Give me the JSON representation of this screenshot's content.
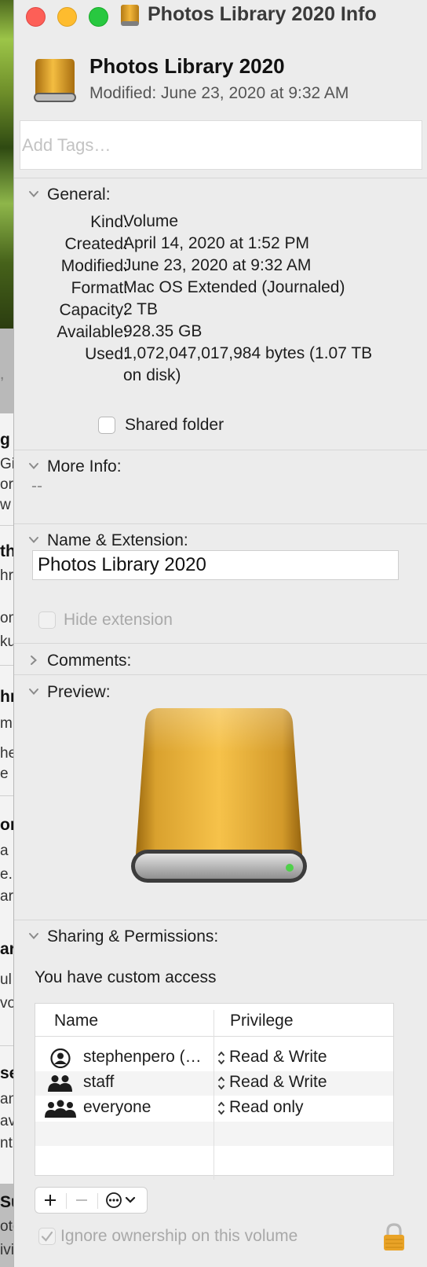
{
  "background": {
    "fragments": [
      ", ",
      "g",
      "Gif",
      "ore",
      "w",
      "th",
      "hri",
      "om",
      "ku",
      "hr",
      "m.",
      "he",
      "e u",
      "or",
      "a",
      "e.",
      "ar",
      "ar",
      "ea",
      "ul",
      "vo",
      "se",
      "an",
      "av",
      "nt",
      "Su",
      "oto",
      "ivi"
    ]
  },
  "window": {
    "title": "Photos Library 2020 Info",
    "controls": [
      "close",
      "minimize",
      "zoom"
    ]
  },
  "header": {
    "name": "Photos Library 2020",
    "modified": "Modified: June 23, 2020 at 9:32 AM"
  },
  "tags": {
    "placeholder": "Add Tags…",
    "value": ""
  },
  "general": {
    "title": "General:",
    "rows": [
      {
        "label": "Kind:",
        "value": "Volume"
      },
      {
        "label": "Created:",
        "value": "April 14, 2020 at 1:52 PM"
      },
      {
        "label": "Modified:",
        "value": "June 23, 2020 at 9:32 AM"
      },
      {
        "label": "Format:",
        "value": "Mac OS Extended (Journaled)"
      },
      {
        "label": "Capacity:",
        "value": "2 TB"
      },
      {
        "label": "Available:",
        "value": "928.35 GB"
      },
      {
        "label": "Used:",
        "value_line1": "1,072,047,017,984 bytes (1.07 TB",
        "value_line2": "on disk)"
      }
    ],
    "shared_folder": {
      "label": "Shared folder",
      "checked": false
    }
  },
  "more_info": {
    "title": "More Info:",
    "value": "--"
  },
  "name_extension": {
    "title": "Name & Extension:",
    "name_value": "Photos Library 2020",
    "hide_extension": {
      "label": "Hide extension",
      "checked": false,
      "enabled": false
    }
  },
  "comments": {
    "title": "Comments:",
    "expanded": false
  },
  "preview": {
    "title": "Preview:"
  },
  "sharing": {
    "title": "Sharing & Permissions:",
    "access_text": "You have custom access",
    "columns": [
      "Name",
      "Privilege"
    ],
    "rows": [
      {
        "name": "stephenpero (…",
        "privilege": "Read & Write",
        "icon": "user-icon"
      },
      {
        "name": "staff",
        "privilege": "Read & Write",
        "icon": "group-icon"
      },
      {
        "name": "everyone",
        "privilege": "Read only",
        "icon": "everyone-icon"
      }
    ],
    "buttons": [
      "add-icon",
      "remove-icon",
      "action-menu-icon"
    ],
    "ignore_ownership": {
      "label": "Ignore ownership on this volume",
      "checked": true,
      "enabled": false
    }
  },
  "colors": {
    "close": "#fd5f57",
    "minimize": "#febc2e",
    "zoom": "#28c840",
    "drive_gold": "#e8a92e",
    "window_bg": "#ececec",
    "lock": "#e9a327"
  }
}
